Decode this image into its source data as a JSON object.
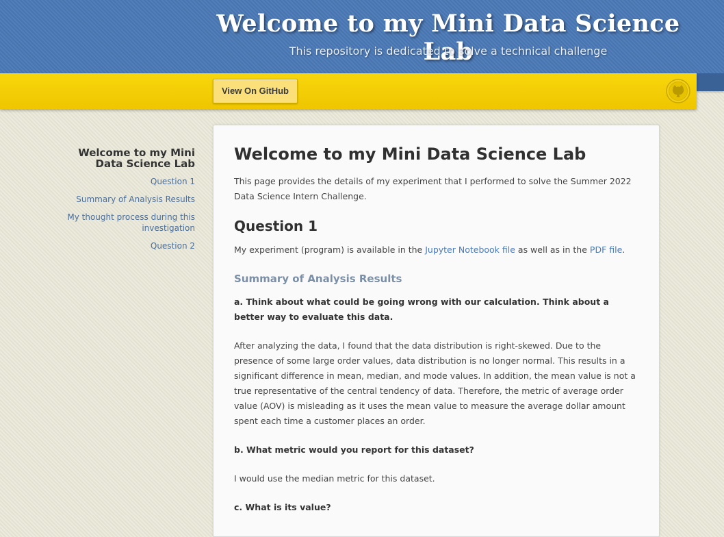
{
  "header": {
    "title": "Welcome to my Mini Data Science Lab",
    "tagline": "This repository is dedicated to solve a technical challenge"
  },
  "ribbon": {
    "github_button": "View On GitHub",
    "icon": "github-octocat-icon"
  },
  "sidebar": {
    "title": "Welcome to my Mini Data Science Lab",
    "items": [
      {
        "label": "Question 1"
      },
      {
        "label": "Summary of Analysis Results"
      },
      {
        "label": "My thought process during this investigation"
      },
      {
        "label": "Question 2"
      }
    ]
  },
  "content": {
    "title": "Welcome to my Mini Data Science Lab",
    "intro": "This page provides the details of my experiment that I performed to solve the Summer 2022 Data Science Intern Challenge.",
    "q1_heading": "Question 1",
    "q1_text_before": "My experiment (program) is available in the ",
    "q1_link_notebook": "Jupyter Notebook file",
    "q1_text_middle": " as well as in the ",
    "q1_link_pdf": "PDF file",
    "q1_text_after": ".",
    "summary_heading": "Summary of Analysis Results",
    "qa": "a. Think about what could be going wrong with our calculation. Think about a better way to evaluate this data.",
    "answer_a": "After analyzing the data, I found that the data distribution is right-skewed. Due to the presence of some large order values, data distribution is no longer normal. This results in a significant difference in mean, median, and mode values. In addition, the mean value is not a true representative of the central tendency of data. Therefore, the metric of average order value (AOV) is misleading as it uses the mean value to measure the average dollar amount spent each time a customer places an order.",
    "qb": "b. What metric would you report for this dataset?",
    "answer_b": "I would use the median metric for this dataset.",
    "qc": "c. What is its value?"
  },
  "colors": {
    "header_blue": "#4b79b6",
    "ribbon_yellow": "#f5d000",
    "link_blue": "#4a7ab8"
  }
}
